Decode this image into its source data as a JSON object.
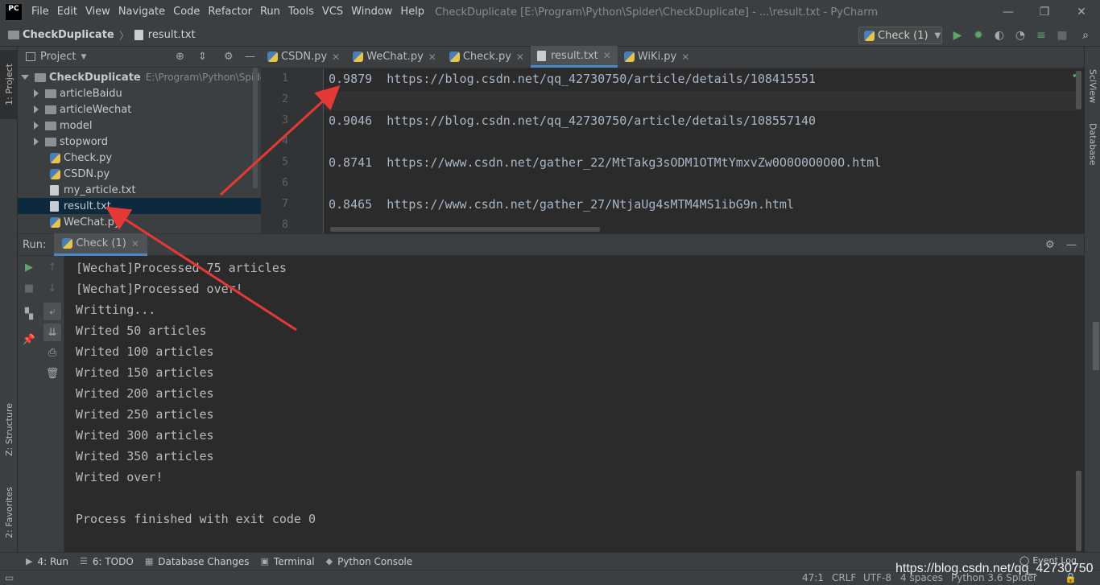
{
  "window": {
    "title": "CheckDuplicate [E:\\Program\\Python\\Spider\\CheckDuplicate] - ...\\result.txt - PyCharm",
    "logo": "PC",
    "minimize": "—",
    "maximize": "❐",
    "close": "✕"
  },
  "menu": [
    "File",
    "Edit",
    "View",
    "Navigate",
    "Code",
    "Refactor",
    "Run",
    "Tools",
    "VCS",
    "Window",
    "Help"
  ],
  "breadcrumb": {
    "project": "CheckDuplicate",
    "file": "result.txt"
  },
  "run_config": {
    "label": "Check (1)"
  },
  "left_strip": {
    "project_tab": "1: Project",
    "structure_tab": "Z: Structure",
    "favorites_tab": "2: Favorites"
  },
  "right_strip": {
    "sciview_tab": "SciView",
    "database_tab": "Database"
  },
  "project_panel": {
    "title": "Project",
    "root": {
      "name": "CheckDuplicate",
      "path": "E:\\Program\\Python\\Spider\\C"
    },
    "folders": [
      "articleBaidu",
      "articleWechat",
      "model",
      "stopword"
    ],
    "files": [
      "Check.py",
      "CSDN.py",
      "my_article.txt",
      "result.txt",
      "WeChat.py"
    ],
    "selected": "result.txt"
  },
  "editor": {
    "tabs": [
      "CSDN.py",
      "WeChat.py",
      "Check.py",
      "result.txt",
      "WiKi.py"
    ],
    "active_tab": "result.txt",
    "line_numbers": [
      "1",
      "2",
      "3",
      "4",
      "5",
      "6",
      "7",
      "8"
    ],
    "lines": [
      "0.9879  https://blog.csdn.net/qq_42730750/article/details/108415551",
      "",
      "0.9046  https://blog.csdn.net/qq_42730750/article/details/108557140",
      "",
      "0.8741  https://www.csdn.net/gather_22/MtTakg3sODM1OTMtYmxvZw0O0O0O0O0O.html",
      "",
      "0.8465  https://www.csdn.net/gather_27/NtjaUg4sMTM4MS1ibG9n.html",
      ""
    ]
  },
  "run_panel": {
    "label": "Run:",
    "tab": "Check (1)",
    "output": [
      "[Wechat]Processed 75 articles",
      "[Wechat]Processed over!",
      "Writting...",
      "Writed 50 articles",
      "Writed 100 articles",
      "Writed 150 articles",
      "Writed 200 articles",
      "Writed 250 articles",
      "Writed 300 articles",
      "Writed 350 articles",
      "Writed over!",
      "",
      "Process finished with exit code 0"
    ]
  },
  "bottom_tabs": [
    {
      "label": "4: Run",
      "icon": "▶"
    },
    {
      "label": "6: TODO",
      "icon": "☰"
    },
    {
      "label": "Database Changes",
      "icon": "▦"
    },
    {
      "label": "Terminal",
      "icon": "▣"
    },
    {
      "label": "Python Console",
      "icon": "◆"
    }
  ],
  "status": {
    "position": "47:1",
    "line_sep": "CRLF",
    "encoding": "UTF-8",
    "indent": "4 spaces",
    "interpreter": "Python 3.6 Spider",
    "event_log": "Event Log"
  },
  "watermark": "https://blog.csdn.net/qq_42730750",
  "colors": {
    "arrow": "#e53935",
    "accent": "#4a88c7",
    "selection": "#0d293e"
  }
}
